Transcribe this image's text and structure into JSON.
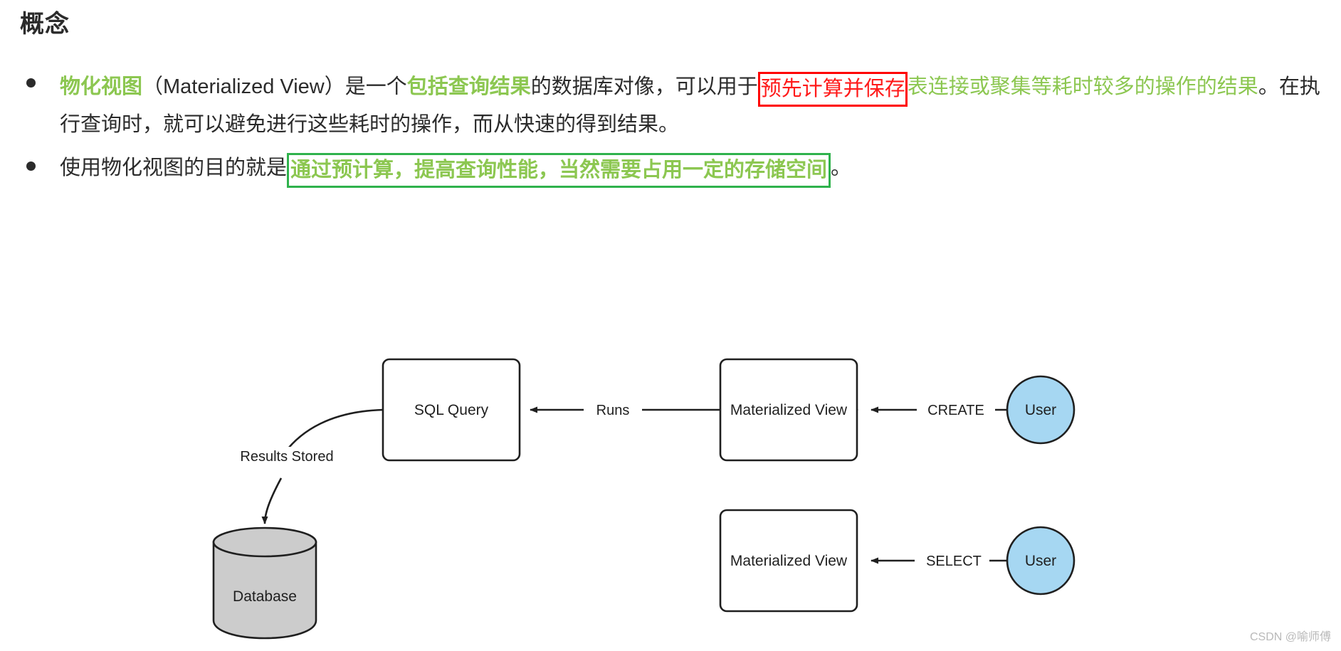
{
  "page": {
    "title": "概念",
    "watermark": "CSDN @喻师傅",
    "colors": {
      "highlight_green": "#8CC751",
      "box_green": "#2FB24C",
      "highlight_red": "#FF1A1A",
      "box_red": "#FF0000",
      "text": "#2b2b2b",
      "node_fill": "#FFFFFF",
      "user_fill": "#A6D7F2",
      "database_fill": "#CCCCCC",
      "stroke": "#1f1f1f"
    }
  },
  "bullets": [
    {
      "id": "bullet-1",
      "segments": [
        {
          "text": "物化视图",
          "style": "green-bold"
        },
        {
          "text": "（Materialized View）是一个",
          "style": "plain"
        },
        {
          "text": "包括查询结果",
          "style": "green-bold"
        },
        {
          "text": "的数据库对像，可以用于",
          "style": "plain"
        },
        {
          "text": "预先计算并保存",
          "style": "red-boxed"
        },
        {
          "text": "表连接或聚集等耗时较多的操作的结果",
          "style": "green-regular"
        },
        {
          "text": "。在执行查询时，就可以避免进行这些耗时的操作，而从快速的得到结果。",
          "style": "plain"
        }
      ]
    },
    {
      "id": "bullet-2",
      "segments": [
        {
          "text": "使用物化视图的目的就是",
          "style": "plain"
        },
        {
          "text": "通过预计算，提高查询性能，当然需要占用一定的存储空间",
          "style": "green-boxed"
        },
        {
          "text": "。",
          "style": "plain"
        }
      ]
    }
  ],
  "diagram": {
    "nodes": [
      {
        "id": "sql-query",
        "label": "SQL Query",
        "shape": "rounded-rect"
      },
      {
        "id": "materialized-view-top",
        "label": "Materialized View",
        "shape": "rounded-rect"
      },
      {
        "id": "user-top",
        "label": "User",
        "shape": "circle"
      },
      {
        "id": "materialized-view-bottom",
        "label": "Materialized View",
        "shape": "rounded-rect"
      },
      {
        "id": "user-bottom",
        "label": "User",
        "shape": "circle"
      },
      {
        "id": "database",
        "label": "Database",
        "shape": "cylinder"
      }
    ],
    "edges": [
      {
        "id": "edge-create",
        "from": "user-top",
        "to": "materialized-view-top",
        "label": "CREATE"
      },
      {
        "id": "edge-runs",
        "from": "materialized-view-top",
        "to": "sql-query",
        "label": "Runs"
      },
      {
        "id": "edge-results-stored",
        "from": "sql-query",
        "to": "database",
        "label": "Results Stored"
      },
      {
        "id": "edge-select",
        "from": "user-bottom",
        "to": "materialized-view-bottom",
        "label": "SELECT"
      }
    ]
  }
}
